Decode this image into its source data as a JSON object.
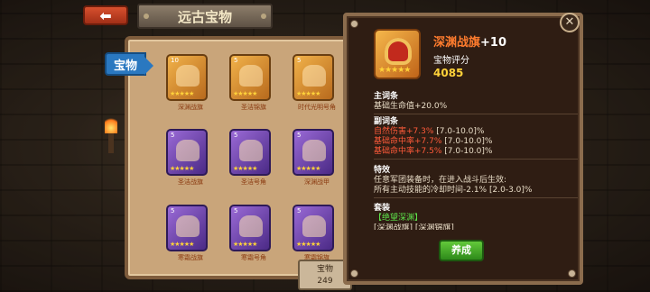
{
  "header": {
    "back_label": "⬅",
    "title": "远古宝物"
  },
  "side_tab": {
    "label": "宝物"
  },
  "treasures": [
    {
      "level": "10",
      "name": "深渊战旗",
      "rarity": "gold",
      "stars": "★★★★★"
    },
    {
      "level": "5",
      "name": "圣洁锦旗",
      "rarity": "gold",
      "stars": "★★★★★"
    },
    {
      "level": "5",
      "name": "时代光明号角",
      "rarity": "gold",
      "stars": "★★★★★"
    },
    {
      "level": "5",
      "name": "圣洁战旗",
      "rarity": "purple",
      "stars": "★★★★★"
    },
    {
      "level": "5",
      "name": "圣洁号角",
      "rarity": "purple",
      "stars": "★★★★★"
    },
    {
      "level": "5",
      "name": "深渊战甲",
      "rarity": "purple",
      "stars": "★★★★★"
    },
    {
      "level": "5",
      "name": "寒霜战旗",
      "rarity": "purple",
      "stars": "★★★★★"
    },
    {
      "level": "5",
      "name": "寒霜号角",
      "rarity": "purple",
      "stars": "★★★★★"
    },
    {
      "level": "5",
      "name": "寒霜锦旗",
      "rarity": "purple",
      "stars": "★★★★★"
    }
  ],
  "score_strip": {
    "label": "宝物",
    "value": "249"
  },
  "detail": {
    "name": "深渊战旗",
    "plus": "+10",
    "stars": "★★★★★",
    "score_label": "宝物评分",
    "score_value": "4085",
    "main_attr": {
      "head": "主词条",
      "line": "基础生命值+20.0%"
    },
    "sub_attr": {
      "head": "副词条",
      "lines": [
        {
          "stat": "自然伤害+7.3%",
          "range": "[7.0-10.0]%"
        },
        {
          "stat": "基础命中率+7.7%",
          "range": "[7.0-10.0]%"
        },
        {
          "stat": "基础命中率+7.5%",
          "range": "[7.0-10.0]%"
        }
      ]
    },
    "effect": {
      "head": "特效",
      "line1": "任意军团装备时，在进入战斗后生效:",
      "line2": "所有主动技能的冷却时间-2.1%",
      "range": "[2.0-3.0]%"
    },
    "set": {
      "head": "套装",
      "name": "【绝望深渊】",
      "cut_line": "[深渊战旗] [深渊锦旗]"
    },
    "close_label": "✕",
    "cultivate_label": "养成"
  },
  "colors": {
    "gold_card": "#f1b24a",
    "purple_card": "#9a6ad6",
    "title_orange": "#ff7c2e",
    "score_yellow": "#ffd23a",
    "red_stat": "#ff5a3a",
    "green_set": "#5de04a",
    "button_green": "#62c93a"
  }
}
